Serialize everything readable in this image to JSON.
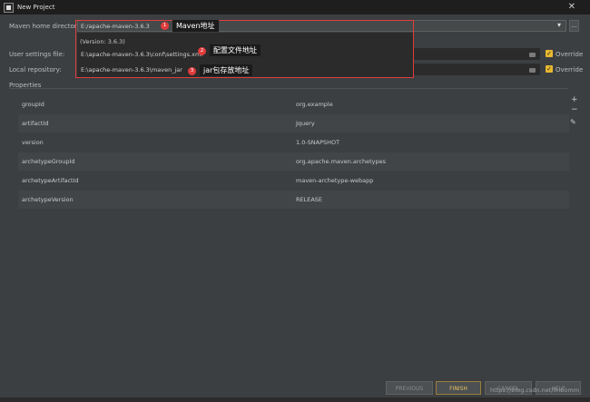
{
  "window": {
    "title": "New Project",
    "close_glyph": "✕"
  },
  "maven": {
    "home_label": "Maven home directory:",
    "home_value": "E:/apache-maven-3.6.3",
    "version_text": "(Version: 3.6.3)",
    "settings_label": "User settings file:",
    "settings_value": "E:\\apache-maven-3.6.3\\conf\\settings.xml",
    "repo_label": "Local repository:",
    "repo_value": "E:\\apache-maven-3.6.3\\maven_jar",
    "override_label": "Override",
    "dropdown_arrow": "▾",
    "browse_button": "...",
    "checkmark": "✓"
  },
  "annotations": [
    {
      "number": "1",
      "text": "Maven地址"
    },
    {
      "number": "2",
      "text": "配置文件地址"
    },
    {
      "number": "3",
      "text": "jar包存放地址"
    }
  ],
  "properties": {
    "heading": "Properties",
    "rows": [
      {
        "key": "groupId",
        "value": "org.example"
      },
      {
        "key": "artifactId",
        "value": "Jquery"
      },
      {
        "key": "version",
        "value": "1.0-SNAPSHOT"
      },
      {
        "key": "archetypeGroupId",
        "value": "org.apache.maven.archetypes"
      },
      {
        "key": "archetypeArtifactId",
        "value": "maven-archetype-webapp"
      },
      {
        "key": "archetypeVersion",
        "value": "RELEASE"
      }
    ],
    "add_glyph": "+",
    "remove_glyph": "−",
    "edit_glyph": "✎"
  },
  "buttons": {
    "previous": "PREVIOUS",
    "finish": "FINISH",
    "cancel": "CANCEL",
    "help": "HELP"
  },
  "watermark": "https://blog.csdn.net/linbomm",
  "colors": {
    "accent": "#e8b830",
    "annotation_red": "#e03c3c",
    "background": "#3c3f41"
  }
}
